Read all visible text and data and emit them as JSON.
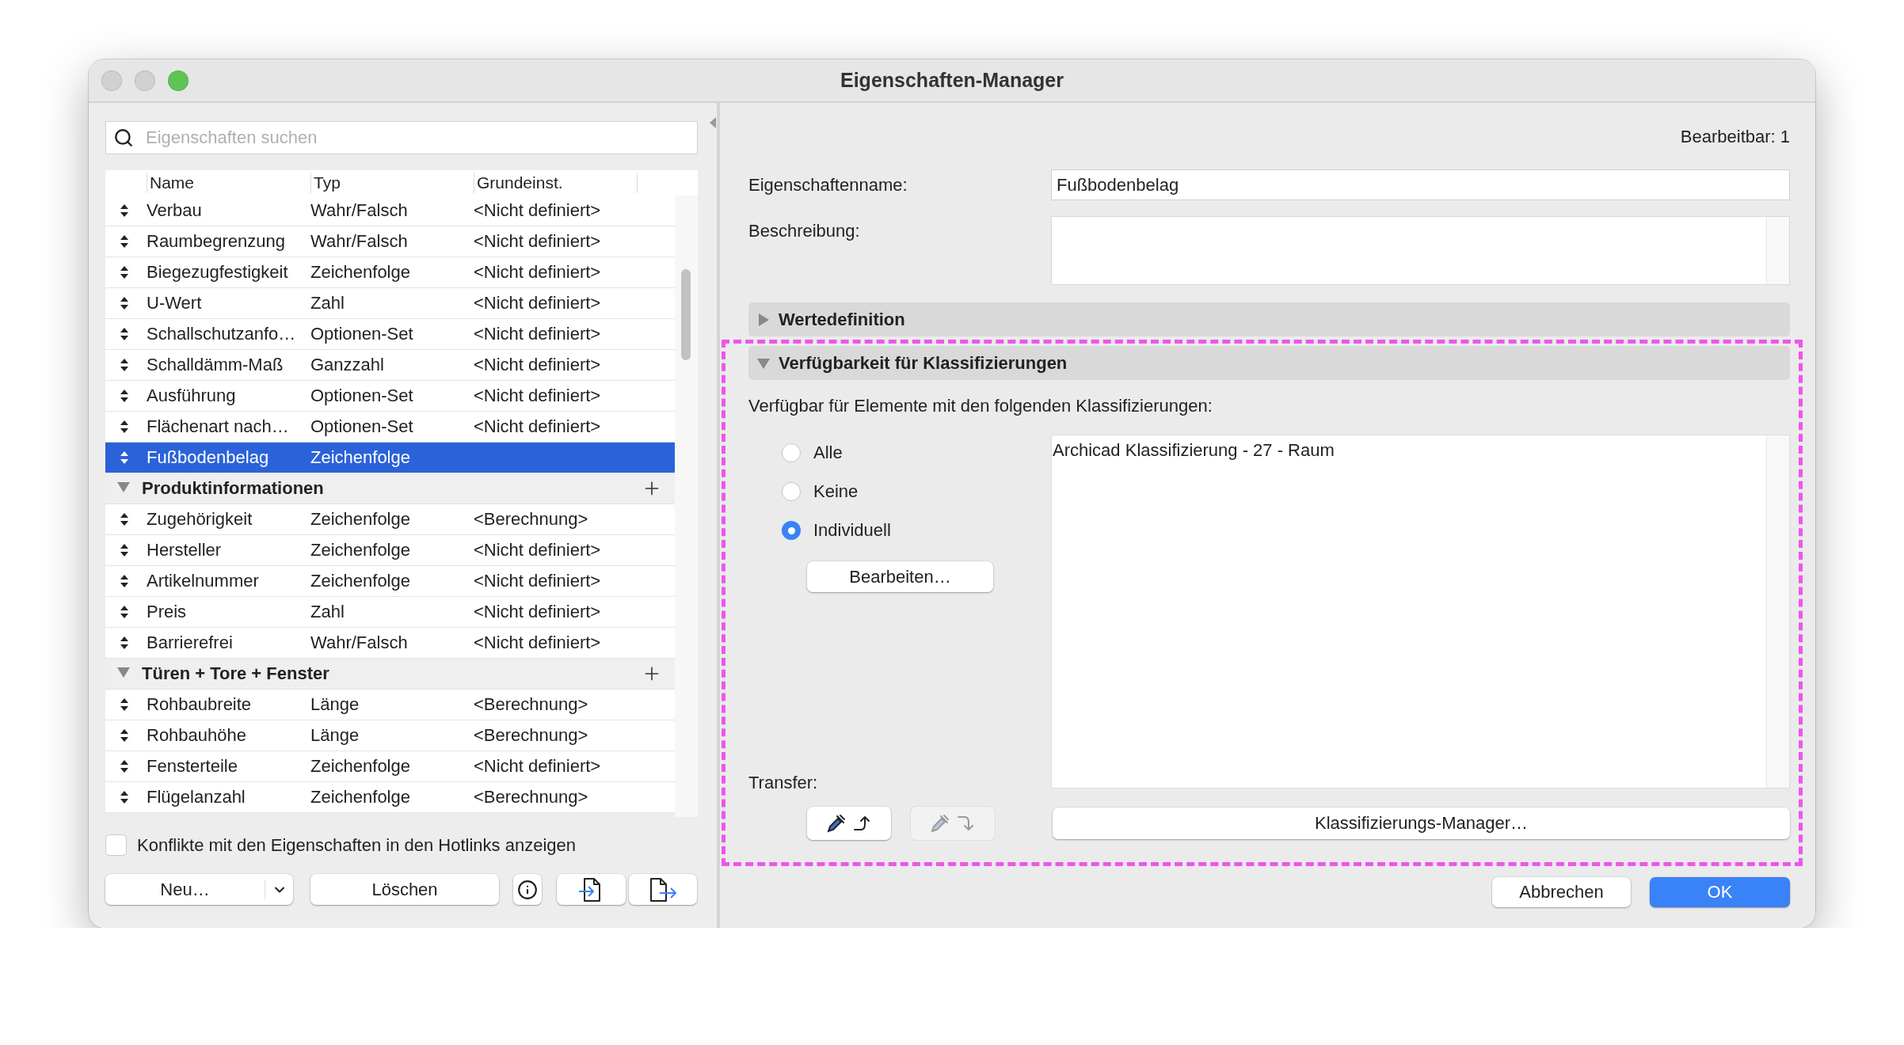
{
  "window": {
    "title": "Eigenschaften-Manager"
  },
  "search": {
    "placeholder": "Eigenschaften suchen"
  },
  "table": {
    "columns": [
      "Name",
      "Typ",
      "Grundeinst."
    ],
    "rows": [
      {
        "kind": "property",
        "name": "Verbau",
        "type": "Wahr/Falsch",
        "default": "<Nicht definiert>",
        "selected": false
      },
      {
        "kind": "property",
        "name": "Raumbegrenzung",
        "type": "Wahr/Falsch",
        "default": "<Nicht definiert>",
        "selected": false
      },
      {
        "kind": "property",
        "name": "Biegezugfestigkeit",
        "type": "Zeichenfolge",
        "default": "<Nicht definiert>",
        "selected": false
      },
      {
        "kind": "property",
        "name": "U-Wert",
        "type": "Zahl",
        "default": "<Nicht definiert>",
        "selected": false
      },
      {
        "kind": "property",
        "name": "Schallschutzanfo…",
        "type": "Optionen-Set",
        "default": "<Nicht definiert>",
        "selected": false
      },
      {
        "kind": "property",
        "name": "Schalldämm-Maß",
        "type": "Ganzzahl",
        "default": "<Nicht definiert>",
        "selected": false
      },
      {
        "kind": "property",
        "name": "Ausführung",
        "type": "Optionen-Set",
        "default": "<Nicht definiert>",
        "selected": false
      },
      {
        "kind": "property",
        "name": "Flächenart nach…",
        "type": "Optionen-Set",
        "default": "<Nicht definiert>",
        "selected": false
      },
      {
        "kind": "property",
        "name": "Fußbodenbelag",
        "type": "Zeichenfolge",
        "selected": true
      },
      {
        "kind": "group",
        "name": "Produktinformationen",
        "expanded": true
      },
      {
        "kind": "property",
        "name": "Zugehörigkeit",
        "type": "Zeichenfolge",
        "default": "<Berechnung>",
        "selected": false
      },
      {
        "kind": "property",
        "name": "Hersteller",
        "type": "Zeichenfolge",
        "default": "<Nicht definiert>",
        "selected": false
      },
      {
        "kind": "property",
        "name": "Artikelnummer",
        "type": "Zeichenfolge",
        "default": "<Nicht definiert>",
        "selected": false
      },
      {
        "kind": "property",
        "name": "Preis",
        "type": "Zahl",
        "default": "<Nicht definiert>",
        "selected": false
      },
      {
        "kind": "property",
        "name": "Barrierefrei",
        "type": "Wahr/Falsch",
        "default": "<Nicht definiert>",
        "selected": false
      },
      {
        "kind": "group",
        "name": "Türen + Tore + Fenster",
        "expanded": true
      },
      {
        "kind": "property",
        "name": "Rohbaubreite",
        "type": "Länge",
        "default": "<Berechnung>",
        "selected": false
      },
      {
        "kind": "property",
        "name": "Rohbauhöhe",
        "type": "Länge",
        "default": "<Berechnung>",
        "selected": false
      },
      {
        "kind": "property",
        "name": "Fensterteile",
        "type": "Zeichenfolge",
        "default": "<Nicht definiert>",
        "selected": false
      },
      {
        "kind": "property",
        "name": "Flügelanzahl",
        "type": "Zeichenfolge",
        "default": "<Berechnung>",
        "selected": false
      }
    ]
  },
  "hotlink_conflicts": {
    "label": "Konflikte mit den Eigenschaften in den Hotlinks anzeigen",
    "checked": false
  },
  "left_buttons": {
    "new": "Neu…",
    "delete": "Löschen"
  },
  "editable": "Bearbeitbar: 1",
  "fields": [
    {
      "kind": "line",
      "label": "Eigenschaftenname:",
      "value": "Fußbodenbelag"
    },
    {
      "kind": "area",
      "label": "Beschreibung:"
    }
  ],
  "sections": [
    {
      "title": "Wertedefinition",
      "expanded": false,
      "highlighted": false
    },
    {
      "title": "Verfügbarkeit für Klassifizierungen",
      "expanded": true,
      "highlighted": true
    }
  ],
  "availability": {
    "intro": "Verfügbar für Elemente mit den folgenden Klassifizierungen:",
    "options": [
      {
        "label": "Alle",
        "selected": false
      },
      {
        "label": "Keine",
        "selected": false
      },
      {
        "label": "Individuell",
        "selected": true
      }
    ],
    "edit_button": "Bearbeiten…",
    "classifications": [
      "Archicad Klassifizierung - 27 - Raum"
    ],
    "transfer_label": "Transfer:",
    "transfer_buttons": [
      {
        "kind": "pick",
        "disabled": false
      },
      {
        "kind": "inject",
        "disabled": true
      }
    ],
    "manager_button": "Klassifizierungs-Manager…"
  },
  "buttons": [
    {
      "label": "Abbrechen",
      "primary": false
    },
    {
      "label": "OK",
      "primary": true
    }
  ]
}
